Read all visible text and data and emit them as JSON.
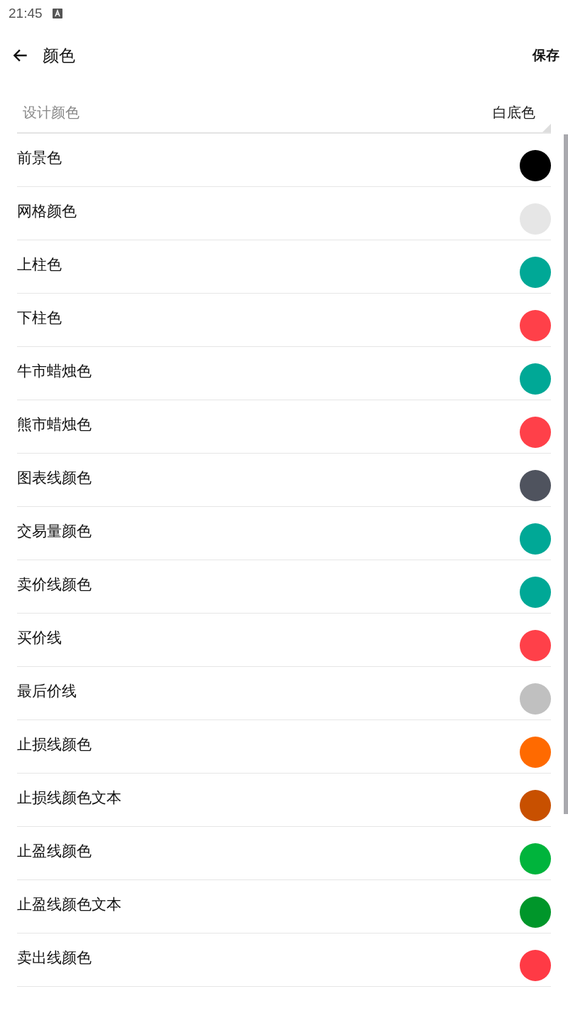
{
  "status_bar": {
    "time": "21:45"
  },
  "header": {
    "title": "颜色",
    "action": "保存"
  },
  "design": {
    "label": "设计颜色",
    "value": "白底色"
  },
  "colors": [
    {
      "name": "前景色",
      "color": "#000000"
    },
    {
      "name": "网格颜色",
      "color": "#e6e6e6"
    },
    {
      "name": "上柱色",
      "color": "#00a896"
    },
    {
      "name": "下柱色",
      "color": "#ff4049"
    },
    {
      "name": "牛市蜡烛色",
      "color": "#00a896"
    },
    {
      "name": "熊市蜡烛色",
      "color": "#ff4049"
    },
    {
      "name": "图表线颜色",
      "color": "#4f535e"
    },
    {
      "name": "交易量颜色",
      "color": "#00a896"
    },
    {
      "name": "卖价线颜色",
      "color": "#00a896"
    },
    {
      "name": "买价线",
      "color": "#ff4049"
    },
    {
      "name": "最后价线",
      "color": "#c0c0c0"
    },
    {
      "name": "止损线颜色",
      "color": "#ff6a00"
    },
    {
      "name": "止损线颜色文本",
      "color": "#c85000"
    },
    {
      "name": "止盈线颜色",
      "color": "#00b43c"
    },
    {
      "name": "止盈线颜色文本",
      "color": "#00962a"
    },
    {
      "name": "卖出线颜色",
      "color": "#ff3a45"
    }
  ]
}
